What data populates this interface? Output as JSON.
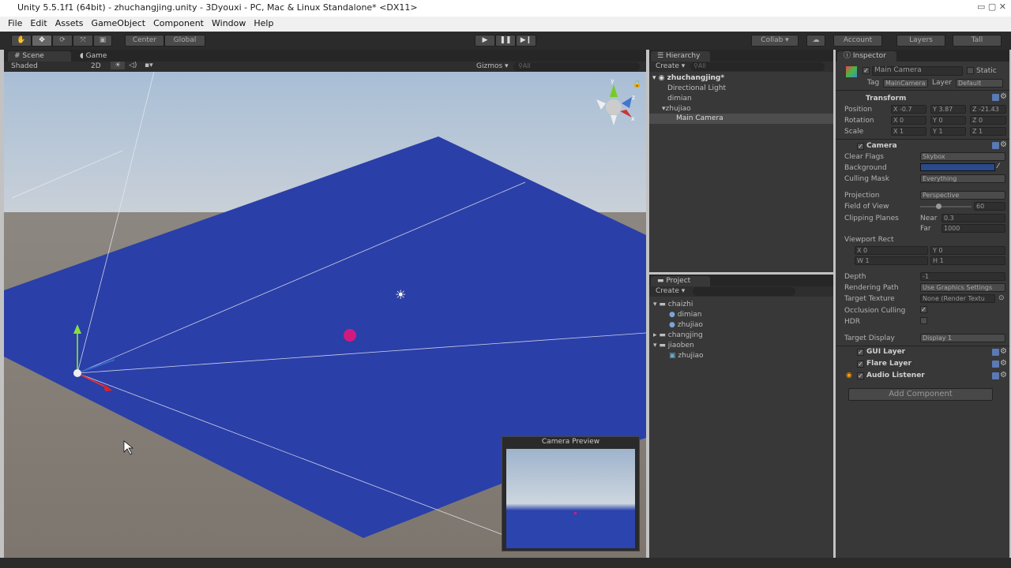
{
  "window": {
    "title": "Unity 5.5.1f1 (64bit) - zhuchangjing.unity - 3Dyouxi - PC, Mac & Linux Standalone* <DX11>"
  },
  "menu": [
    "File",
    "Edit",
    "Assets",
    "GameObject",
    "Component",
    "Window",
    "Help"
  ],
  "toolbar": {
    "center": "Center",
    "global": "Global",
    "collab": "Collab ▾",
    "account": "Account",
    "layers": "Layers",
    "layout": "Tall"
  },
  "scene": {
    "tab_scene": "Scene",
    "tab_game": "Game",
    "shading": "Shaded",
    "mode2d": "2D",
    "gizmos": "Gizmos",
    "search": "All",
    "camera_preview": "Camera Preview",
    "axis_y": "y",
    "axis_z": "z",
    "axis_x": "x"
  },
  "hierarchy": {
    "title": "Hierarchy",
    "create": "Create",
    "search": "All",
    "scene": "zhuchangjing*",
    "items": [
      "Directional Light",
      "dimian",
      "zhujiao",
      "Main Camera"
    ]
  },
  "project": {
    "title": "Project",
    "create": "Create",
    "items": [
      "chaizhi",
      "dimian",
      "zhujiao",
      "changjing",
      "jiaoben",
      "zhujiao"
    ]
  },
  "inspector": {
    "title": "Inspector",
    "name": "Main Camera",
    "static": "Static",
    "tag_label": "Tag",
    "tag": "MainCamera",
    "layer_label": "Layer",
    "layer": "Default",
    "transform": {
      "title": "Transform",
      "position": "Position",
      "rotation": "Rotation",
      "scale": "Scale",
      "pos": [
        "-0.7",
        "3.87",
        "-21.43"
      ],
      "rot": [
        "0",
        "0",
        "0"
      ],
      "scl": [
        "1",
        "1",
        "1"
      ]
    },
    "camera": {
      "title": "Camera",
      "clear_flags": "Clear Flags",
      "clear_flags_val": "Skybox",
      "background": "Background",
      "background_color": "#2a4a8a",
      "culling_mask": "Culling Mask",
      "culling_mask_val": "Everything",
      "projection": "Projection",
      "projection_val": "Perspective",
      "fov": "Field of View",
      "fov_val": "60",
      "clipping": "Clipping Planes",
      "near": "Near",
      "near_val": "0.3",
      "far": "Far",
      "far_val": "1000",
      "viewport": "Viewport Rect",
      "vx": "0",
      "vy": "0",
      "vw": "1",
      "vh": "1",
      "depth": "Depth",
      "depth_val": "-1",
      "rendering_path": "Rendering Path",
      "rendering_path_val": "Use Graphics Settings",
      "target_texture": "Target Texture",
      "target_texture_val": "None (Render Textu",
      "occlusion": "Occlusion Culling",
      "hdr": "HDR",
      "target_display": "Target Display",
      "target_display_val": "Display 1"
    },
    "components": [
      "GUI Layer",
      "Flare Layer",
      "Audio Listener"
    ],
    "add_component": "Add Component"
  }
}
